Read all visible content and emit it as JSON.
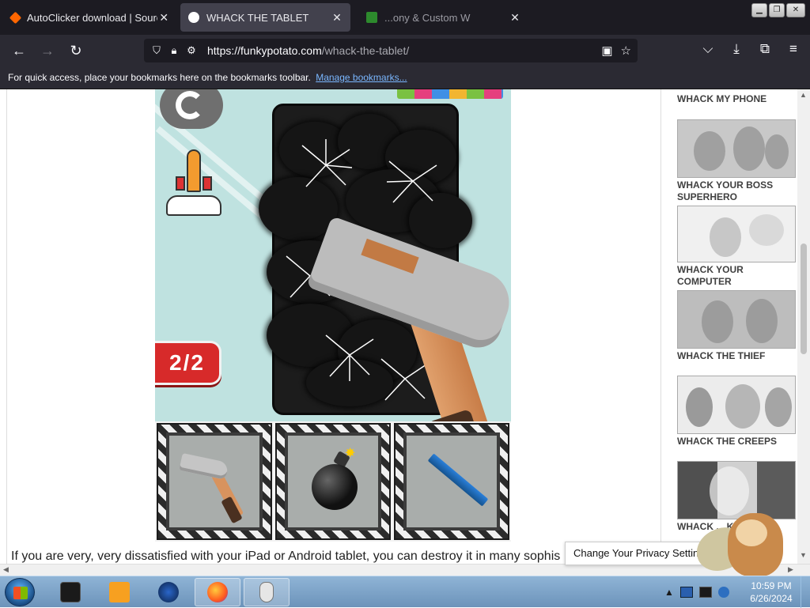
{
  "browser": {
    "tabs": [
      {
        "title": "AutoClicker download | SourceF",
        "active": false
      },
      {
        "title": "WHACK THE TABLET",
        "active": true
      },
      {
        "title": "...ony & Custom W",
        "active": false
      }
    ],
    "url_host": "https://funkypotato.com",
    "url_path": "/whack-the-tablet/",
    "bookmarks_text": "For quick access, place your bookmarks here on the bookmarks toolbar.",
    "bookmarks_link": "Manage bookmarks...",
    "tab_close_glyph": "✕"
  },
  "icons": {
    "back": "back-arrow-icon",
    "forward": "forward-arrow-icon",
    "reload": "reload-icon",
    "shield": "tracking-shield-icon",
    "lock": "lock-icon",
    "permissions": "permissions-icon",
    "reader": "reader-view-icon",
    "bookmark_star": "bookmark-star-icon",
    "pocket": "pocket-icon",
    "downloads": "downloads-icon",
    "extensions": "extensions-icon",
    "menu": "hamburger-menu-icon"
  },
  "game": {
    "score": "2/2",
    "tools": [
      "hammer",
      "bomb",
      "pen"
    ]
  },
  "article": {
    "text": "If you are very, very dissatisfied with your iPad or Android tablet, you can destroy it in many sophis"
  },
  "sidebar": {
    "items": [
      {
        "label": "WHACK MY PHONE"
      },
      {
        "label": "WHACK YOUR BOSS SUPERHERO"
      },
      {
        "label": "WHACK YOUR COMPUTER"
      },
      {
        "label": "WHACK THE THIEF"
      },
      {
        "label": "WHACK THE CREEPS"
      },
      {
        "label": "WHACK ... KILLER"
      }
    ]
  },
  "privacy": {
    "label": "Change Your Privacy Settings"
  },
  "taskbar": {
    "time": "10:59 PM",
    "date": "6/26/2024"
  },
  "colors": {
    "game_bg": "#bfe2e0",
    "score_red": "#d72a2a",
    "browser_dark": "#2b2a33",
    "link_blue": "#7ab7ff"
  }
}
